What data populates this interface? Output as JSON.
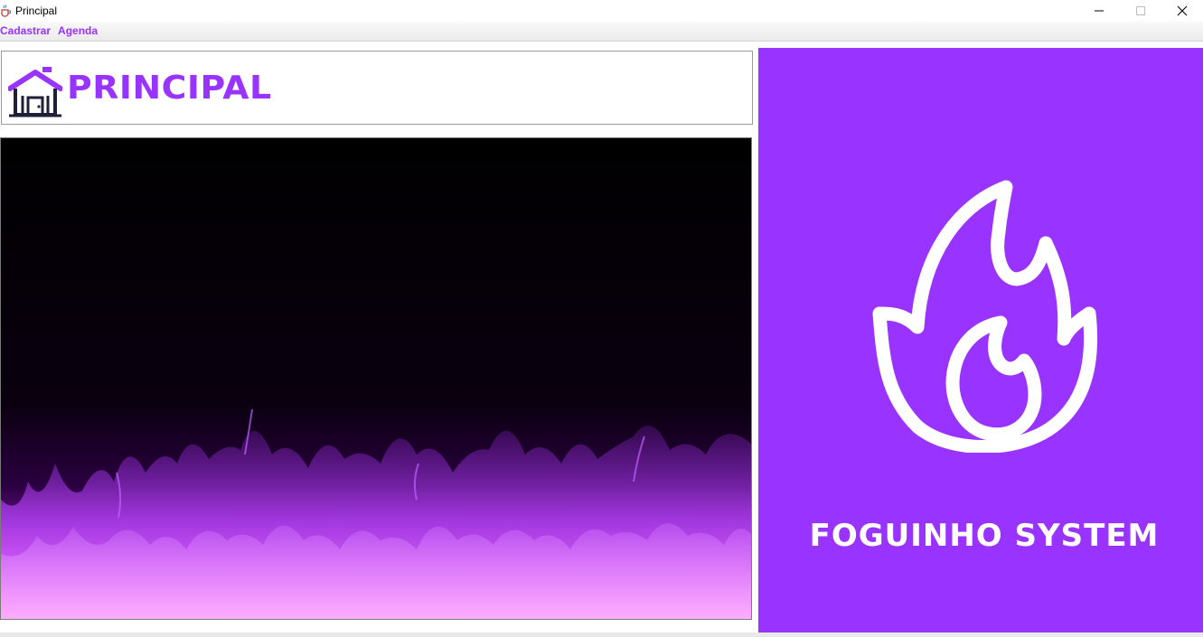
{
  "window": {
    "title": "Principal",
    "icons": {
      "app": "java-cup-icon",
      "minimize": "minimize-icon",
      "maximize": "maximize-icon",
      "close": "close-icon"
    }
  },
  "menu": {
    "items": [
      {
        "label": "Cadastrar"
      },
      {
        "label": "Agenda"
      }
    ]
  },
  "header": {
    "title": "PRINCIPAL",
    "icon": "house-icon"
  },
  "banner": {
    "image": "purple-flames-image"
  },
  "brand": {
    "name": "FOGUINHO SYSTEM",
    "logo": "flame-logo-icon"
  },
  "colors": {
    "accent": "#9933ff",
    "menu_text": "#9b30ff",
    "brand_text": "#ffffff",
    "flame": "#cc33ff",
    "house_dark": "#1f1f3a"
  }
}
